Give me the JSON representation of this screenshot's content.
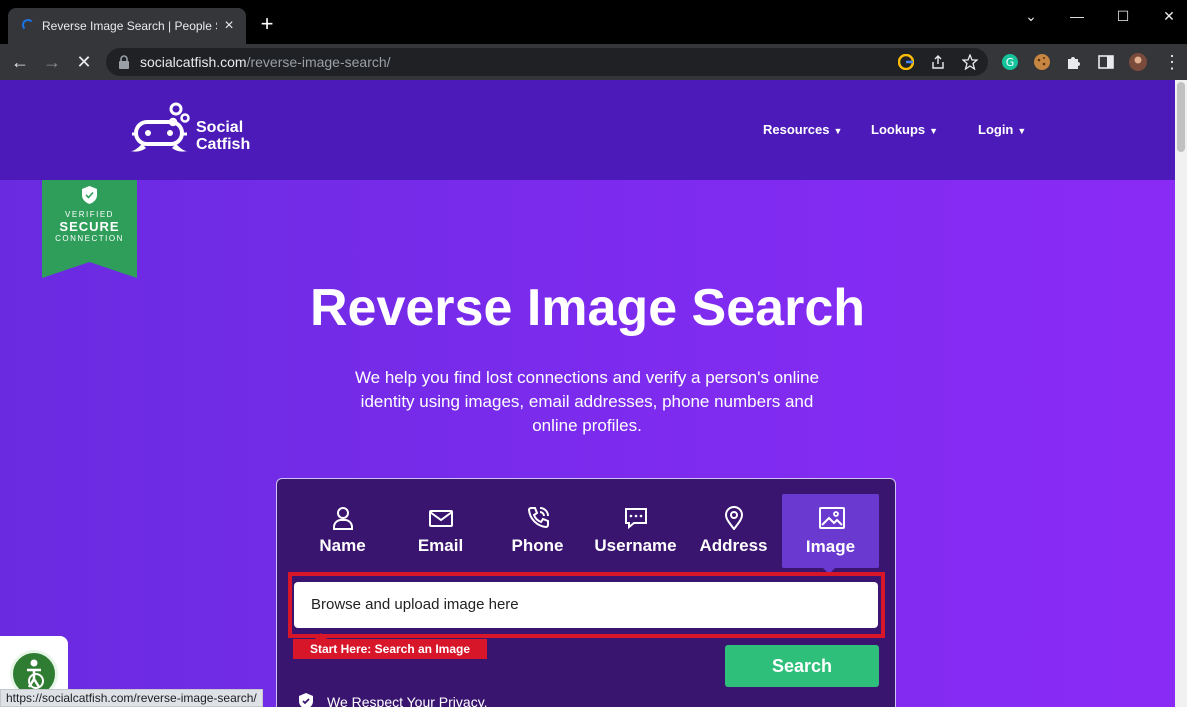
{
  "browser": {
    "tab_title": "Reverse Image Search | People Se",
    "url_host": "socialcatfish.com",
    "url_path": "/reverse-image-search/",
    "status_url": "https://socialcatfish.com/reverse-image-search/"
  },
  "header": {
    "logo_line1": "Social",
    "logo_line2": "Catfish",
    "nav": [
      "Resources",
      "Lookups",
      "Login"
    ]
  },
  "badge": {
    "line1": "VERIFIED",
    "line2": "SECURE",
    "line3": "CONNECTION"
  },
  "hero": {
    "title": "Reverse Image Search",
    "subtitle": "We help you find lost connections and verify a person's online identity using images, email addresses, phone numbers and online profiles."
  },
  "search": {
    "tabs": [
      "Name",
      "Email",
      "Phone",
      "Username",
      "Address",
      "Image"
    ],
    "active_tab": "Image",
    "upload_placeholder": "Browse and upload image here",
    "hint": "Start Here: Search an Image",
    "button": "Search",
    "privacy": "We Respect Your Privacy."
  },
  "colors": {
    "header_bg": "#4c1ab8",
    "page_bg": "#7f2bf0",
    "card_bg": "#3a1570",
    "search_green": "#2ebf7a",
    "highlight_red": "#d8162a",
    "badge_green": "#2f9e5b"
  }
}
